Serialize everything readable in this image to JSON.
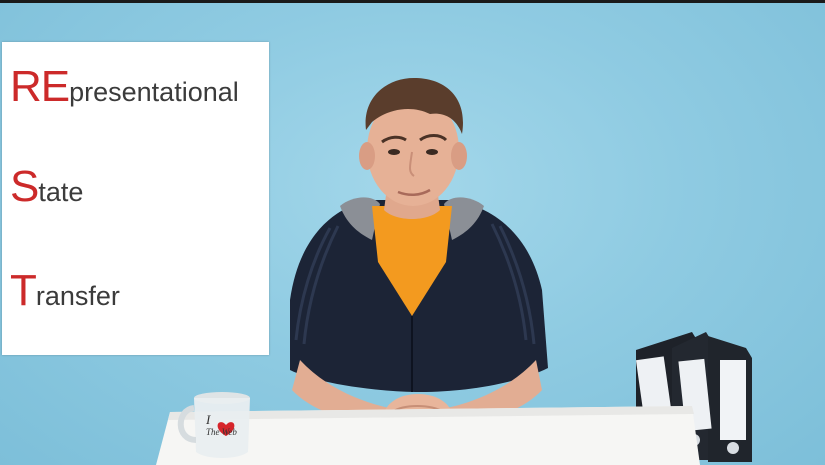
{
  "slide": {
    "lines": [
      {
        "initial": "RE",
        "rest": "presentational"
      },
      {
        "initial": "S",
        "rest": "tate"
      },
      {
        "initial": "T",
        "rest": "ransfer"
      }
    ]
  },
  "mug": {
    "text_line1": "I",
    "text_line2": "The Web"
  },
  "colors": {
    "background": "#8fcbe2",
    "accent_red": "#cc2a2a",
    "slide_text": "#3b3b3b",
    "shirt_orange": "#f39a1f",
    "jacket_navy": "#1c2436"
  }
}
